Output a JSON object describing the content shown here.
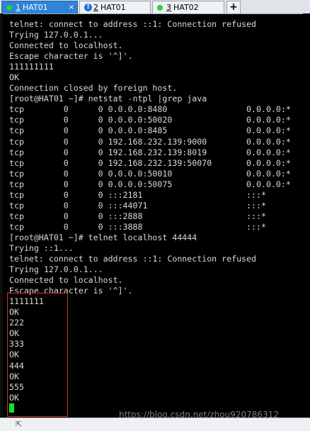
{
  "tabs": [
    {
      "number": "1",
      "title": "HAT01",
      "status": "green",
      "active": true,
      "close": "×"
    },
    {
      "number": "2",
      "title": "HAT01",
      "status": "warn",
      "active": false
    },
    {
      "number": "3",
      "title": "HAT02",
      "status": "green",
      "active": false
    }
  ],
  "new_tab_label": "+",
  "terminal": {
    "lines": [
      "telnet: connect to address ::1: Connection refused",
      "Trying 127.0.0.1...",
      "Connected to localhost.",
      "Escape character is '^]'.",
      "111111111",
      "OK",
      "Connection closed by foreign host.",
      "[root@HAT01 ~]# netstat -ntpl |grep java",
      "tcp        0      0 0.0.0.0:8480                0.0.0.0:*",
      "tcp        0      0 0.0.0.0:50020               0.0.0.0:*",
      "tcp        0      0 0.0.0.0:8485                0.0.0.0:*",
      "tcp        0      0 192.168.232.139:9000        0.0.0.0:*",
      "tcp        0      0 192.168.232.139:8019        0.0.0.0:*",
      "tcp        0      0 192.168.232.139:50070       0.0.0.0:*",
      "tcp        0      0 0.0.0.0:50010               0.0.0.0:*",
      "tcp        0      0 0.0.0.0:50075               0.0.0.0:*",
      "tcp        0      0 :::2181                     :::*",
      "tcp        0      0 :::44071                    :::*",
      "tcp        0      0 :::2888                     :::*",
      "tcp        0      0 :::3888                     :::*",
      "[root@HAT01 ~]# telnet localhost 44444",
      "Trying ::1...",
      "telnet: connect to address ::1: Connection refused",
      "Trying 127.0.0.1...",
      "Connected to localhost.",
      "Escape character is '^]'.",
      "1111111",
      "OK",
      "222",
      "OK",
      "333",
      "OK",
      "444",
      "OK",
      "555",
      "OK"
    ]
  },
  "watermark": "https://blog.csdn.net/zhou920786312",
  "status_icon": "⇱",
  "colors": {
    "cursor": "#19e01c",
    "highlight_box": "#d1342a",
    "active_tab": "#2f84d8"
  }
}
